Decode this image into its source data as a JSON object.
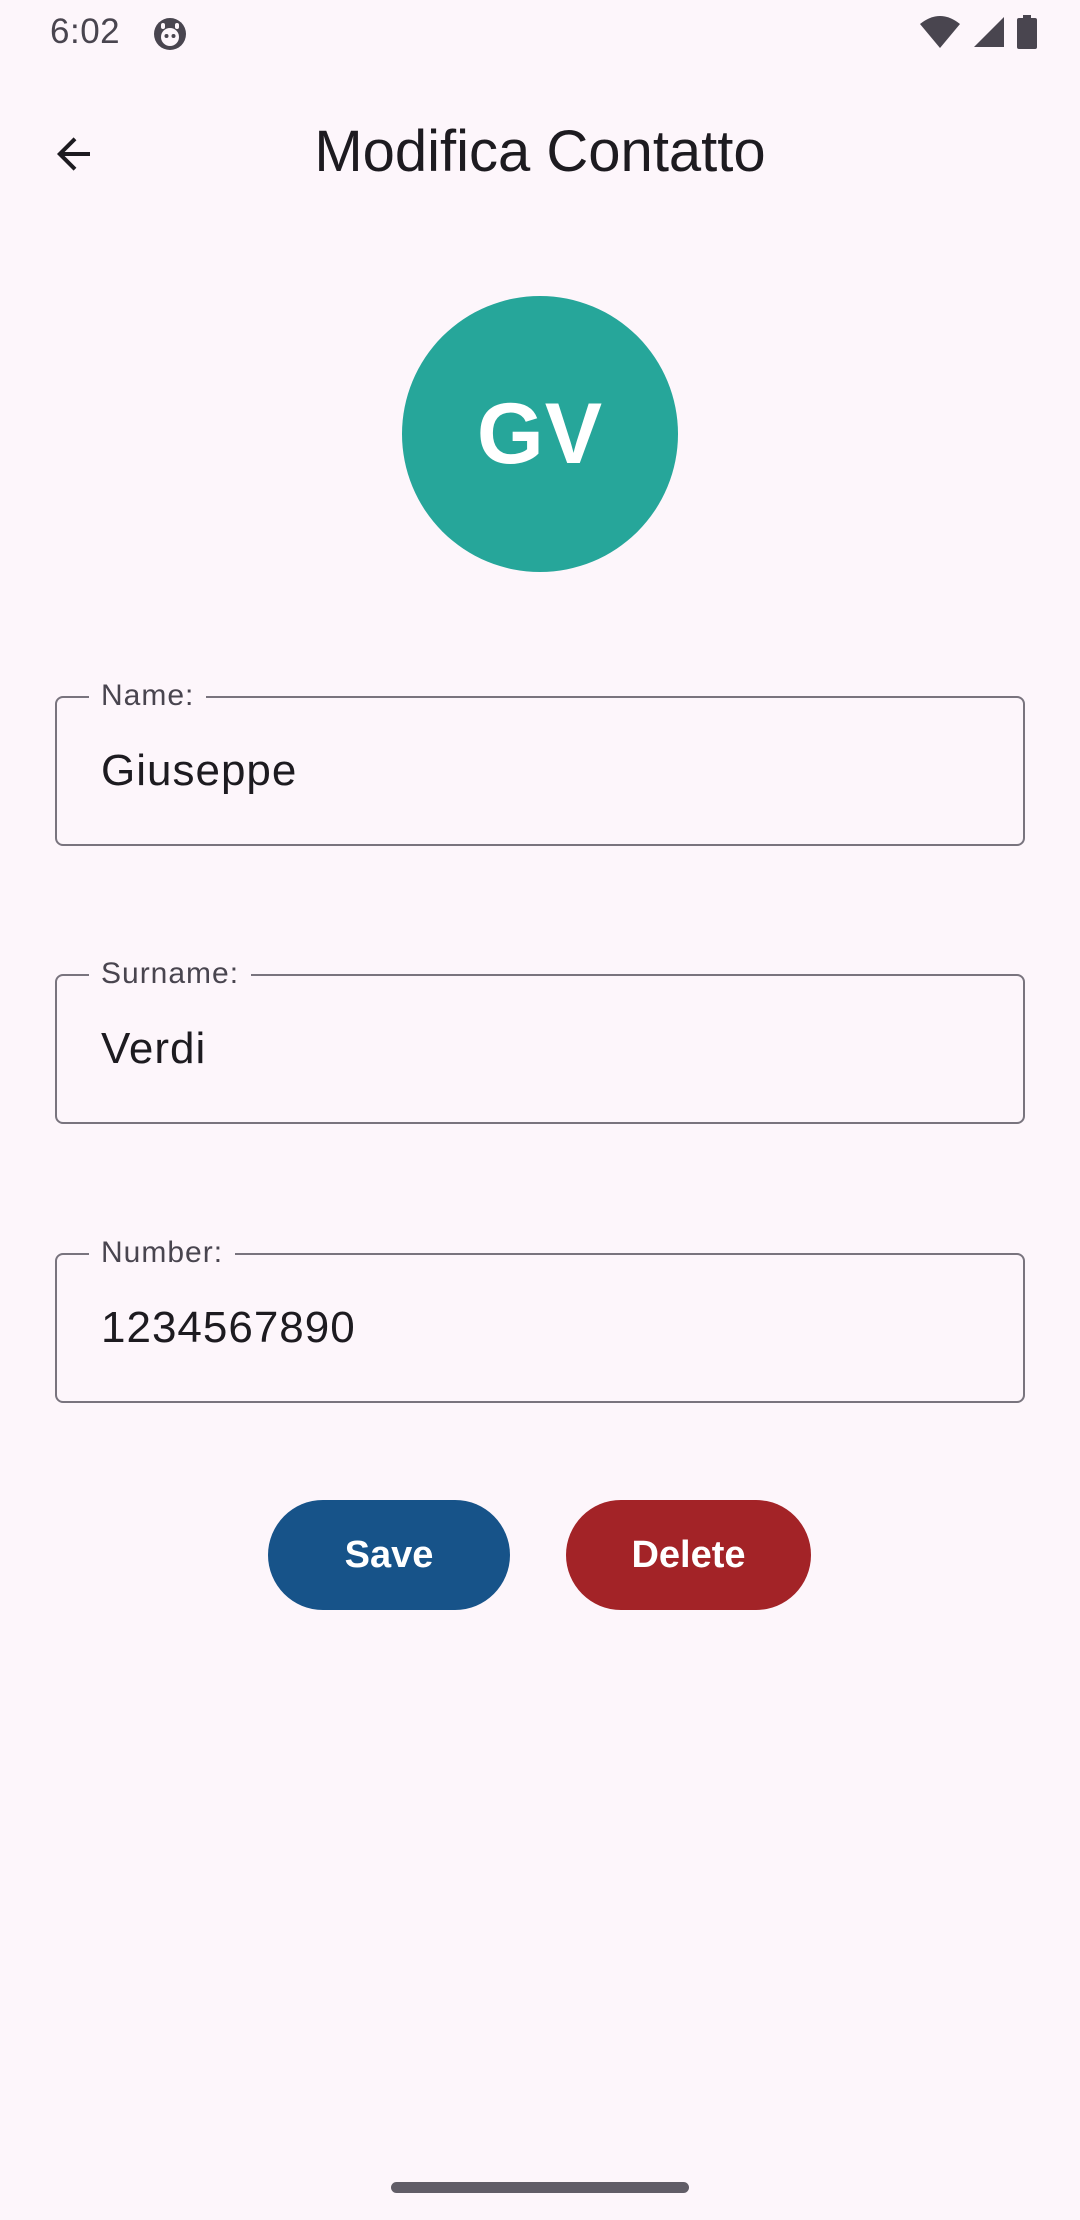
{
  "status_bar": {
    "time": "6:02",
    "icons": [
      "debug-icon",
      "wifi-icon",
      "cell-signal-icon",
      "battery-icon"
    ]
  },
  "app_bar": {
    "title": "Modifica Contatto",
    "back_icon": "arrow-back-icon"
  },
  "avatar": {
    "initials": "GV",
    "color": "#26a69a"
  },
  "form": {
    "name": {
      "label": "Name:",
      "value": "Giuseppe"
    },
    "surname": {
      "label": "Surname:",
      "value": "Verdi"
    },
    "number": {
      "label": "Number:",
      "value": "1234567890"
    }
  },
  "actions": {
    "save_label": "Save",
    "delete_label": "Delete",
    "save_color": "#175389",
    "delete_color": "#a32327"
  },
  "colors": {
    "background": "#fdf6fb",
    "outline": "#79747e",
    "text": "#1d1b20"
  }
}
